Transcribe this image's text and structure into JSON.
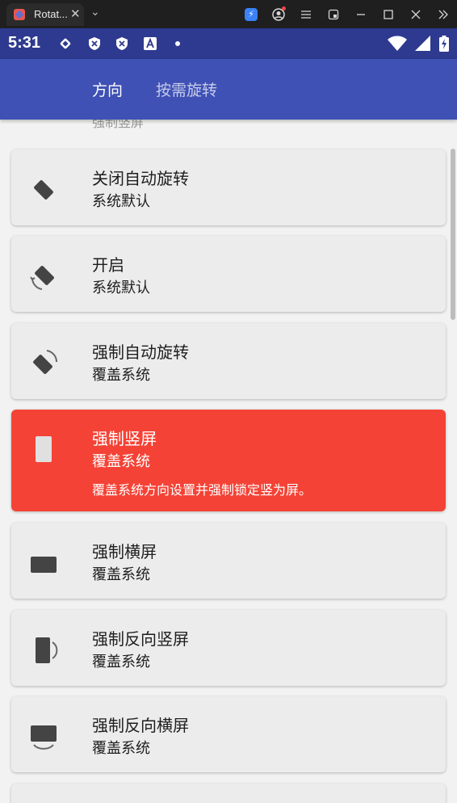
{
  "browser": {
    "tab_title": "Rotat...",
    "close": "✕",
    "dropdown": "⌄"
  },
  "status": {
    "time": "5:31"
  },
  "appbar": {
    "tabs": [
      {
        "label": "方向"
      },
      {
        "label": "按需旋转"
      }
    ]
  },
  "previous_item_label": "强制竖屏",
  "options": [
    {
      "title": "关闭自动旋转",
      "subtitle": "系统默认",
      "icon": "rotation-lock-icon"
    },
    {
      "title": "开启",
      "subtitle": "系统默认",
      "icon": "auto-rotate-icon"
    },
    {
      "title": "强制自动旋转",
      "subtitle": "覆盖系统",
      "icon": "force-auto-rotate-icon"
    },
    {
      "title": "强制竖屏",
      "subtitle": "覆盖系统",
      "description": "覆盖系统方向设置并强制锁定竖为屏。",
      "icon": "portrait-icon",
      "selected": true
    },
    {
      "title": "强制横屏",
      "subtitle": "覆盖系统",
      "icon": "landscape-icon"
    },
    {
      "title": "强制反向竖屏",
      "subtitle": "覆盖系统",
      "icon": "reverse-portrait-icon"
    },
    {
      "title": "强制反向横屏",
      "subtitle": "覆盖系统",
      "icon": "reverse-landscape-icon"
    }
  ],
  "colors": {
    "status_bar": "#2e3a8f",
    "app_bar": "#3f51b5",
    "selected_card": "#f44336"
  }
}
